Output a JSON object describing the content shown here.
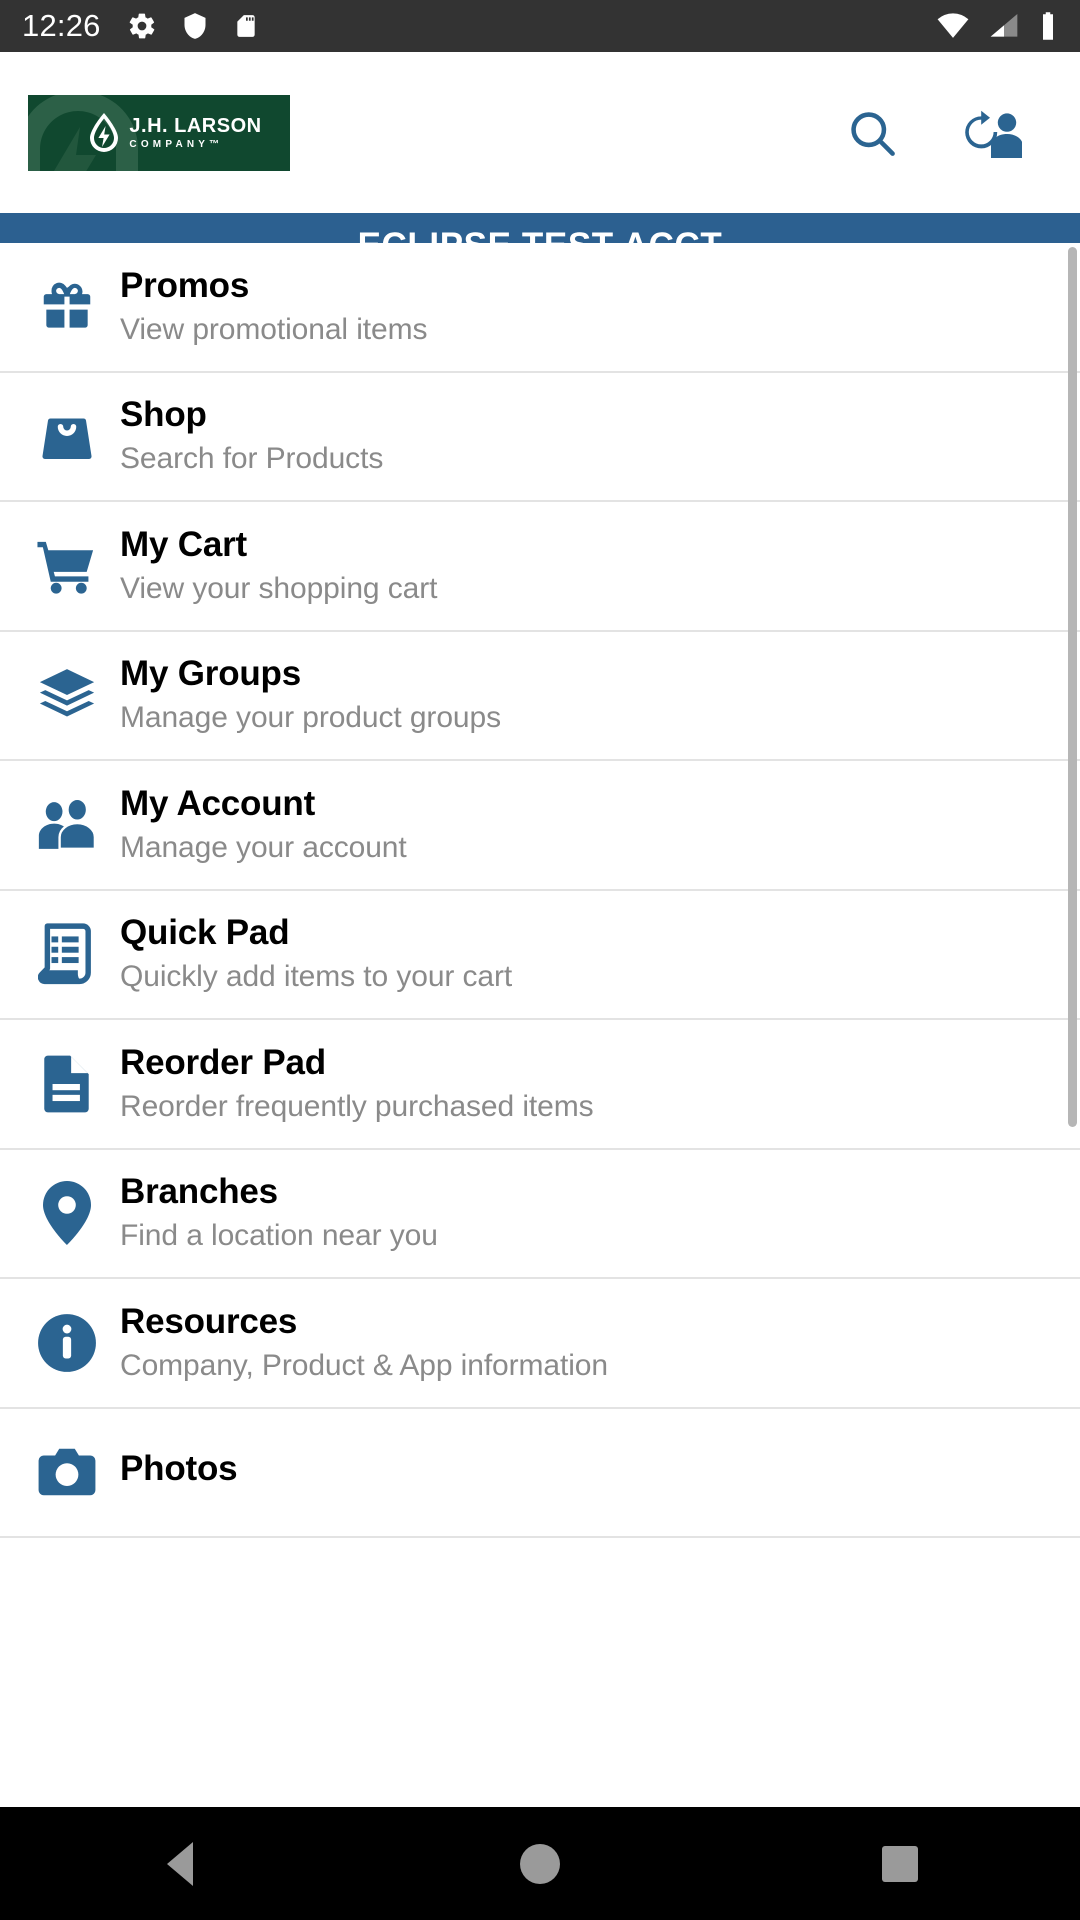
{
  "status_bar": {
    "time": "12:26",
    "left_icons": [
      "gear-icon",
      "shield-icon",
      "sd-card-icon"
    ],
    "right_icons": [
      "wifi-icon",
      "cellular-signal-icon",
      "battery-icon"
    ]
  },
  "header": {
    "logo": {
      "name": "J.H. LARSON",
      "sub": "COMPANY™",
      "bg_color": "#10482f"
    },
    "actions": [
      {
        "name": "search-icon",
        "label": "Search"
      },
      {
        "name": "switch-account-icon",
        "label": "Switch Account"
      }
    ]
  },
  "account_banner": {
    "label": "ECLIPSE TEST ACCT",
    "bg_color": "#2c6090"
  },
  "menu": {
    "accent_color": "#2b6491",
    "items": [
      {
        "icon": "gift-icon",
        "title": "Promos",
        "subtitle": "View promotional items"
      },
      {
        "icon": "shopping-bag-icon",
        "title": "Shop",
        "subtitle": "Search for Products"
      },
      {
        "icon": "shopping-cart-icon",
        "title": "My Cart",
        "subtitle": "View your shopping cart"
      },
      {
        "icon": "layers-icon",
        "title": "My Groups",
        "subtitle": "Manage your product groups"
      },
      {
        "icon": "people-icon",
        "title": "My Account",
        "subtitle": "Manage your account"
      },
      {
        "icon": "receipt-list-icon",
        "title": "Quick Pad",
        "subtitle": "Quickly add items to your cart"
      },
      {
        "icon": "document-icon",
        "title": "Reorder Pad",
        "subtitle": "Reorder frequently purchased items"
      },
      {
        "icon": "map-pin-icon",
        "title": "Branches",
        "subtitle": "Find a location near you"
      },
      {
        "icon": "info-circle-icon",
        "title": "Resources",
        "subtitle": "Company, Product & App information"
      },
      {
        "icon": "camera-icon",
        "title": "Photos",
        "subtitle": ""
      }
    ]
  },
  "nav_bar": {
    "buttons": [
      {
        "name": "back-button",
        "icon": "triangle-left-icon"
      },
      {
        "name": "home-button",
        "icon": "circle-icon"
      },
      {
        "name": "recents-button",
        "icon": "square-icon"
      }
    ]
  }
}
